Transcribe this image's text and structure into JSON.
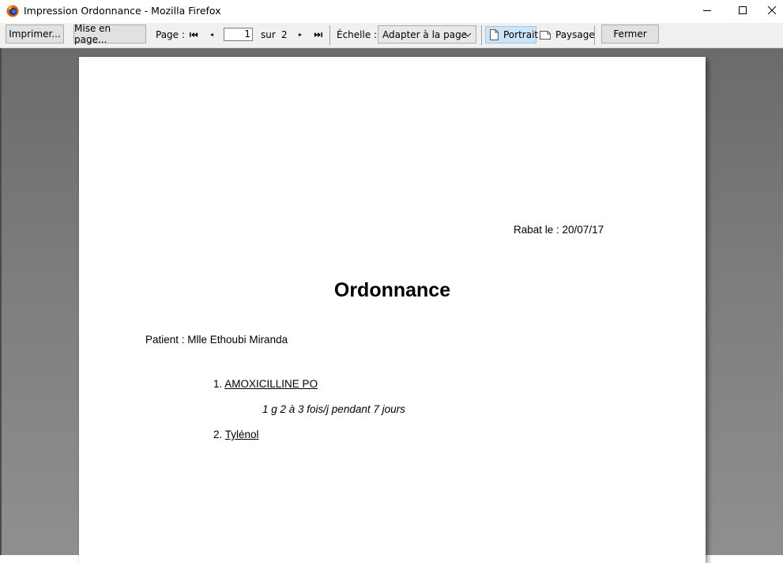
{
  "window": {
    "title": "Impression Ordonnance - Mozilla Firefox"
  },
  "toolbar": {
    "print_label": "Imprimer...",
    "page_setup_label": "Mise en page...",
    "page_label": "Page :",
    "current_page": "1",
    "of_label": "sur",
    "total_pages": "2",
    "scale_label": "Échelle :",
    "scale_value": "Adapter à la page",
    "portrait_label": "Portrait",
    "landscape_label": "Paysage",
    "close_label": "Fermer"
  },
  "document": {
    "date_line": "Rabat le : 20/07/17",
    "title": "Ordonnance",
    "patient_line": "Patient : Mlle Ethoubi Miranda",
    "items": [
      {
        "number": "1.",
        "name": "AMOXICILLINE PO",
        "dosage": "1 g 2 à 3 fois/j pendant 7 jours"
      },
      {
        "number": "2.",
        "name": "Tylénol"
      }
    ]
  }
}
